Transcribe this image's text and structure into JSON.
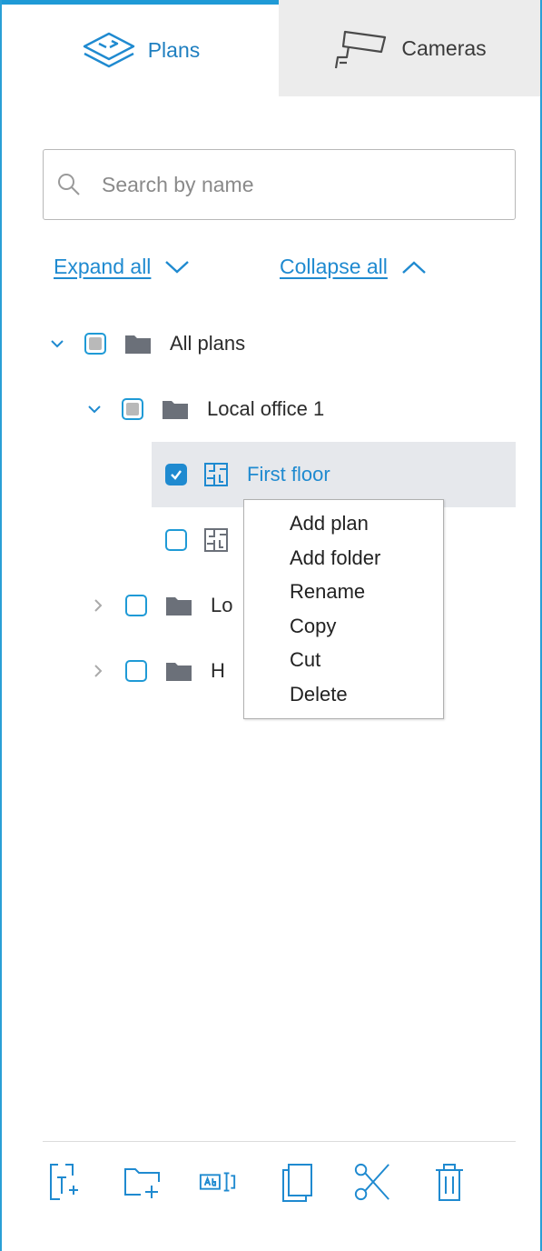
{
  "tabs": [
    {
      "label": "Plans",
      "icon": "layers-icon",
      "active": true
    },
    {
      "label": "Cameras",
      "icon": "camera-icon",
      "active": false
    }
  ],
  "search": {
    "placeholder": "Search by name",
    "value": ""
  },
  "actions": {
    "expand_all": "Expand all",
    "collapse_all": "Collapse all"
  },
  "tree": [
    {
      "label": "All plans",
      "type": "folder",
      "expanded": true,
      "check": "partial"
    },
    {
      "label": "Local office 1",
      "type": "folder",
      "expanded": true,
      "check": "partial"
    },
    {
      "label": "First floor",
      "type": "plan",
      "check": "checked",
      "selected": true
    },
    {
      "label": "",
      "type": "plan",
      "check": "unchecked"
    },
    {
      "label": "Lo",
      "type": "folder",
      "expanded": false,
      "check": "unchecked"
    },
    {
      "label": "H",
      "type": "folder",
      "expanded": false,
      "check": "unchecked"
    }
  ],
  "context_menu": [
    "Add plan",
    "Add folder",
    "Rename",
    "Copy",
    "Cut",
    "Delete"
  ],
  "toolbar": [
    "add-plan-icon",
    "add-folder-icon",
    "rename-icon",
    "copy-icon",
    "cut-icon",
    "delete-icon"
  ],
  "colors": {
    "accent": "#1f9ad6",
    "link": "#1f8ad0",
    "selected_bg": "#e6e8ec",
    "folder": "#6b7079"
  }
}
